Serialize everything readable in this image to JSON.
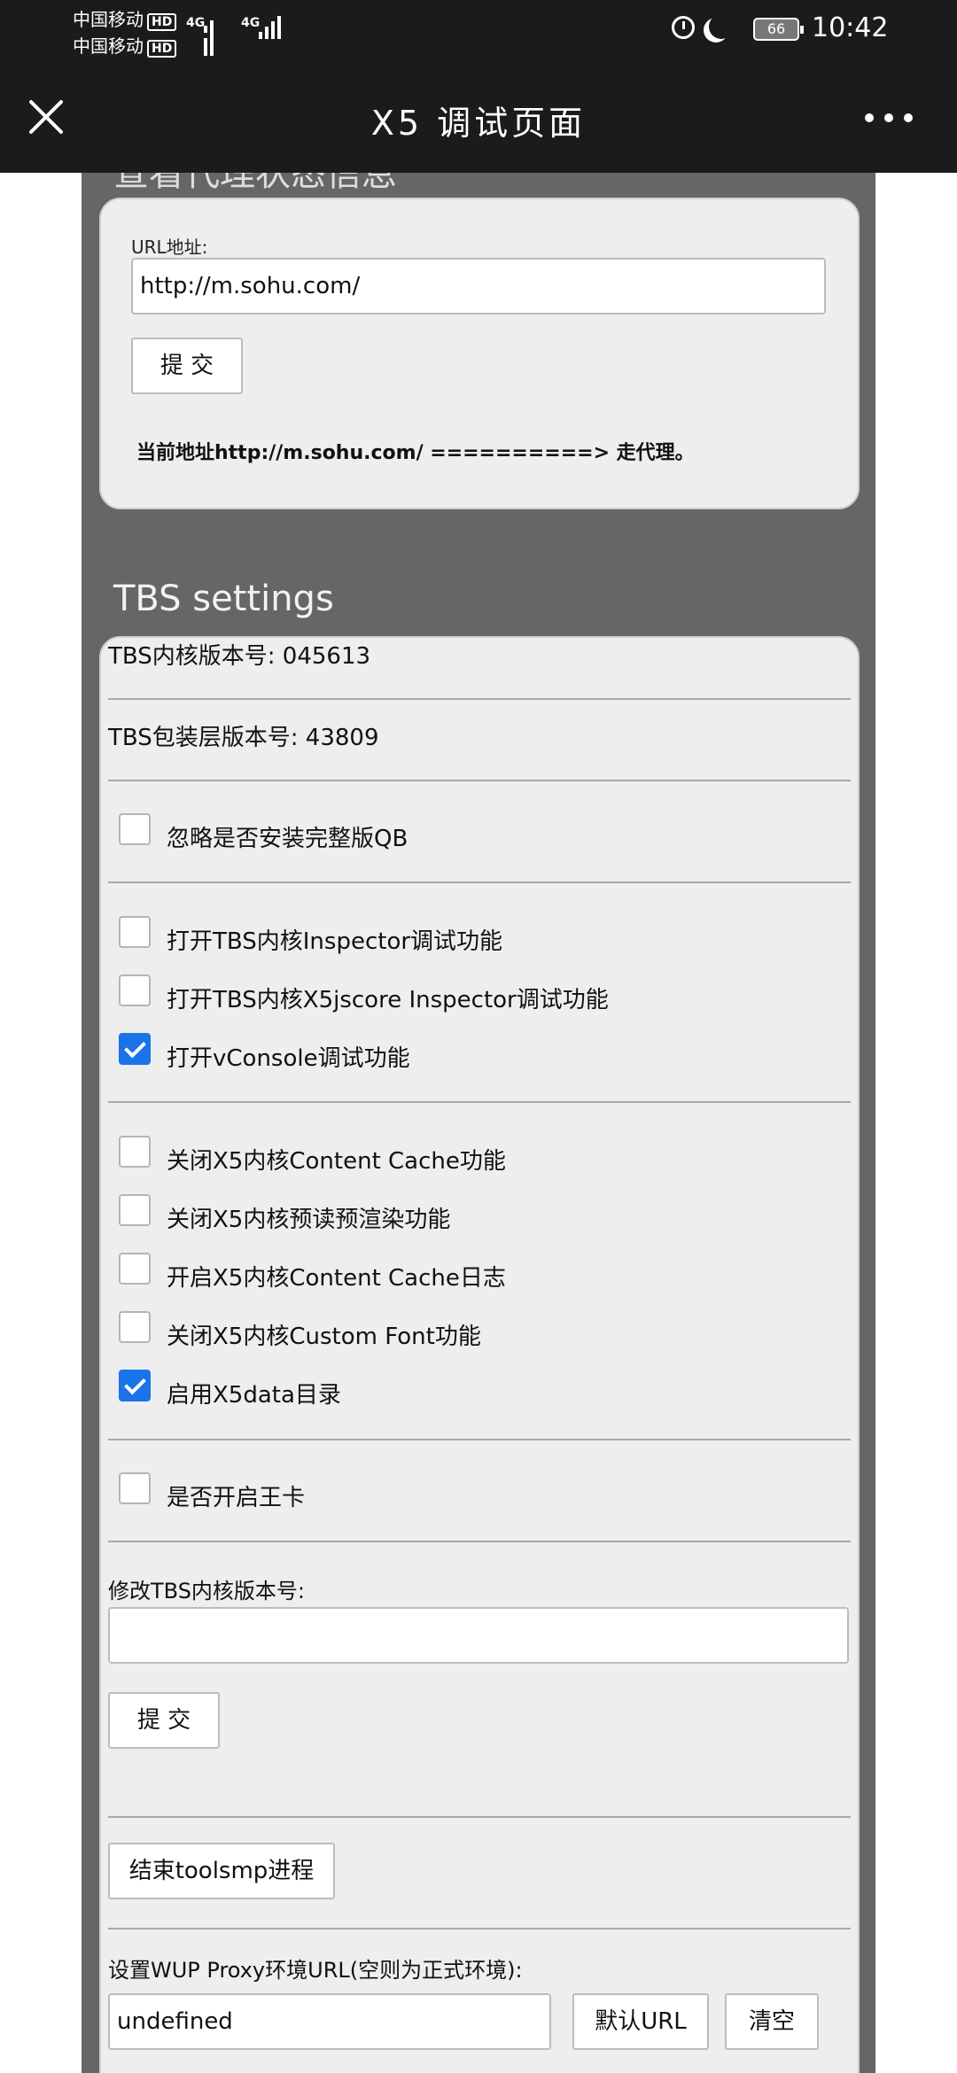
{
  "status_bar": {
    "carrier1": "中国移动",
    "carrier2": "中国移动",
    "hd_badge": "HD",
    "network1": "4G",
    "network2": "4G",
    "battery": "66",
    "time": "10:42"
  },
  "header": {
    "title": "X5 调试页面"
  },
  "proxy_section": {
    "heading_clipped": "查看代理状态信息",
    "url_label": "URL地址:",
    "url_value": "http://m.sohu.com/",
    "submit_label": "提 交",
    "status_text": "当前地址http://m.sohu.com/ ==========> 走代理。"
  },
  "tbs_section": {
    "heading": "TBS settings",
    "kernel_version": "TBS内核版本号: 045613",
    "wrapper_version": "TBS包装层版本号: 43809",
    "checkbox_groups": [
      [
        {
          "label": "忽略是否安装完整版QB",
          "checked": false
        }
      ],
      [
        {
          "label": "打开TBS内核Inspector调试功能",
          "checked": false
        },
        {
          "label": "打开TBS内核X5jscore Inspector调试功能",
          "checked": false
        },
        {
          "label": "打开vConsole调试功能",
          "checked": true
        }
      ],
      [
        {
          "label": "关闭X5内核Content Cache功能",
          "checked": false
        },
        {
          "label": "关闭X5内核预读预渲染功能",
          "checked": false
        },
        {
          "label": "开启X5内核Content Cache日志",
          "checked": false
        },
        {
          "label": "关闭X5内核Custom Font功能",
          "checked": false
        },
        {
          "label": "启用X5data目录",
          "checked": true
        }
      ],
      [
        {
          "label": "是否开启王卡",
          "checked": false
        }
      ]
    ],
    "modify_version_label": "修改TBS内核版本号:",
    "modify_version_value": "",
    "modify_submit_label": "提 交",
    "kill_process_label": "结束toolsmp进程",
    "wup_label": "设置WUP Proxy环境URL(空则为正式环境):",
    "wup_value": "undefined",
    "default_url_label": "默认URL",
    "clear_label": "清空"
  }
}
